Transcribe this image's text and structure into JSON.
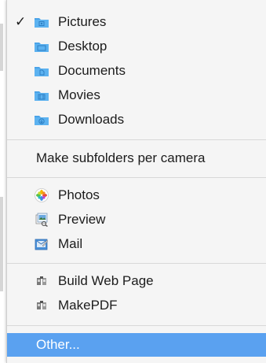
{
  "menu": {
    "folders": [
      {
        "label": "Pictures",
        "icon": "pictures-folder-icon",
        "checked": true
      },
      {
        "label": "Desktop",
        "icon": "desktop-folder-icon",
        "checked": false
      },
      {
        "label": "Documents",
        "icon": "documents-folder-icon",
        "checked": false
      },
      {
        "label": "Movies",
        "icon": "movies-folder-icon",
        "checked": false
      },
      {
        "label": "Downloads",
        "icon": "downloads-folder-icon",
        "checked": false
      }
    ],
    "subfolders_option": "Make subfolders per camera",
    "apps": [
      {
        "label": "Photos",
        "icon": "photos-app-icon"
      },
      {
        "label": "Preview",
        "icon": "preview-app-icon"
      },
      {
        "label": "Mail",
        "icon": "mail-app-icon"
      }
    ],
    "automator": [
      {
        "label": "Build Web Page",
        "icon": "automator-workflow-icon"
      },
      {
        "label": "MakePDF",
        "icon": "automator-workflow-icon"
      }
    ],
    "other": {
      "label": "Other...",
      "selected": true
    },
    "checkmark": "✓"
  },
  "colors": {
    "menu_background": "#f5f5f5",
    "folder_blue": "#4aa3e8",
    "selection": "#5aa1f0",
    "separator": "#d8d8d8",
    "text": "#1c1c1c"
  }
}
